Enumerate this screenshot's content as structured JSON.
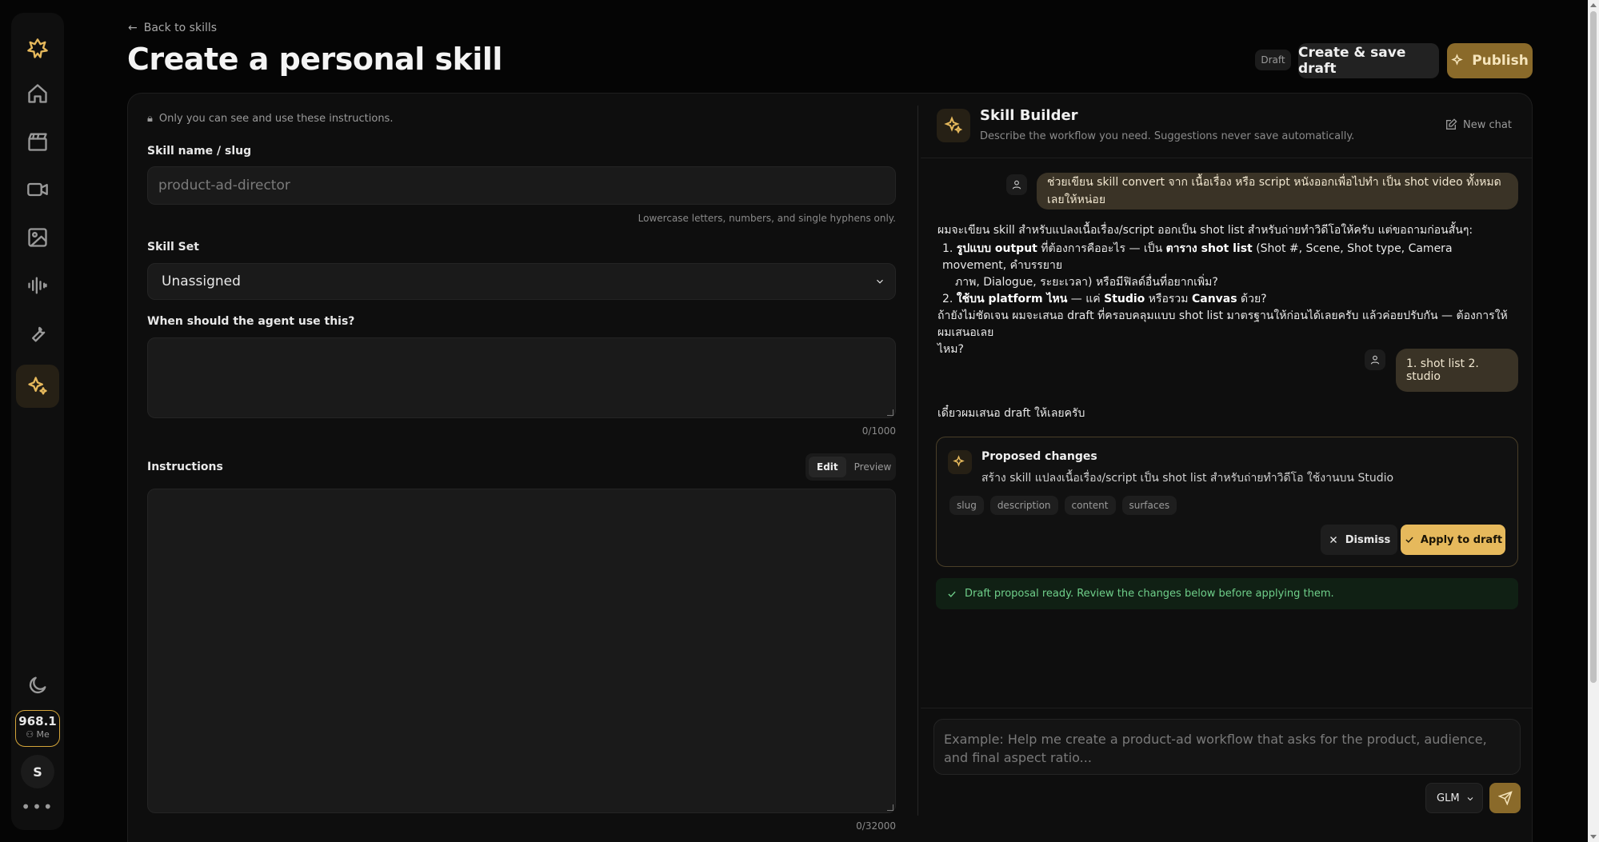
{
  "nav": {
    "credits_value": "968.1",
    "credits_label": "Me",
    "avatar_initial": "S",
    "more_label": "•••"
  },
  "header": {
    "back_label": "Back to skills",
    "title": "Create a personal skill",
    "status_badge": "Draft",
    "save_label": "Create & save draft",
    "publish_label": "Publish"
  },
  "form": {
    "privacy_note": "Only you can see and use these instructions.",
    "name_label": "Skill name / slug",
    "name_placeholder": "product-ad-director",
    "name_hint": "Lowercase letters, numbers, and single hyphens only.",
    "skillset_label": "Skill Set",
    "skillset_value": "Unassigned",
    "when_label": "When should the agent use this?",
    "when_count": "0/1000",
    "instructions_label": "Instructions",
    "tab_edit": "Edit",
    "tab_preview": "Preview",
    "instructions_count": "0/32000"
  },
  "builder": {
    "title": "Skill Builder",
    "subtitle": "Describe the workflow you need. Suggestions never save automatically.",
    "new_chat": "New chat",
    "user_msg_1": "ช่วยเขียน skill convert จาก เนื้อเรื่อง หรือ script หนังออกเพื่อไปทำ เป็น shot video ทั้งหมดเลยให้หน่อย",
    "ai_intro": "ผมจะเขียน skill สำหรับแปลงเนื้อเรื่อง/script ออกเป็น shot list สำหรับถ่ายทำวิดีโอให้ครับ แต่ขอถามก่อนสั้นๆ:",
    "q1_num": "1.",
    "q1_bold": "รูปแบบ output",
    "q1_mid": " ที่ต้องการคืออะไร — เป็น ",
    "q1_bold2": "ตาราง shot list",
    "q1_rest": " (Shot #, Scene, Shot type, Camera movement, คำบรรยาย",
    "q1_line2": "ภาพ, Dialogue, ระยะเวลา) หรือมีฟิลด์อื่นที่อยากเพิ่ม?",
    "q2_num": "2.",
    "q2_bold": "ใช้บน platform ไหน",
    "q2_mid": " — แค่ ",
    "q2_bold2": "Studio",
    "q2_mid2": " หรือรวม ",
    "q2_bold3": "Canvas",
    "q2_rest": " ด้วย?",
    "ai_outro_1": "ถ้ายังไม่ชัดเจน ผมจะเสนอ draft ที่ครอบคลุมแบบ shot list มาตรฐานให้ก่อนได้เลยครับ แล้วค่อยปรับกัน — ต้องการให้ผมเสนอเลย",
    "ai_outro_2": "ไหม?",
    "user_msg_2": "1. shot list 2. studio",
    "ai_reply": "เดี๋ยวผมเสนอ draft ให้เลยครับ",
    "proposal_title": "Proposed changes",
    "proposal_desc": "สร้าง skill แปลงเนื้อเรื่อง/script เป็น shot list สำหรับถ่ายทำวิดีโอ ใช้งานบน Studio",
    "chips": [
      "slug",
      "description",
      "content",
      "surfaces"
    ],
    "dismiss_label": "Dismiss",
    "apply_label": "Apply to draft",
    "status_text": "Draft proposal ready. Review the changes below before applying them.",
    "composer_placeholder": "Example: Help me create a product-ad workflow that asks for the product, audience, and final aspect ratio...",
    "model": "GLM"
  },
  "colors": {
    "accent": "#e6b95c",
    "accent_dark": "#8a6a2a",
    "success": "#6fcf8a"
  }
}
